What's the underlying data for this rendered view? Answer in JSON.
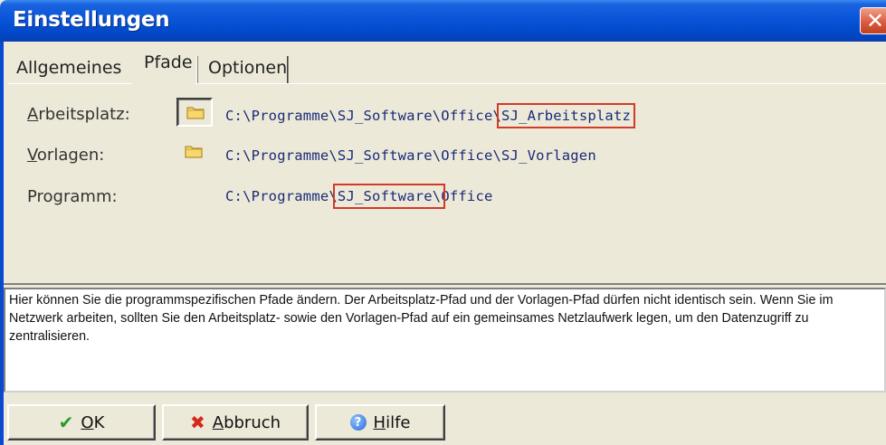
{
  "window": {
    "title": "Einstellungen"
  },
  "tabs": [
    {
      "label": "Allgemeines"
    },
    {
      "label": "Pfade"
    },
    {
      "label": "Optionen"
    }
  ],
  "paths": {
    "arbeitsplatz": {
      "label_key": "A",
      "label_rest": "rbeitsplatz:",
      "value_prefix": "C:\\Programme\\SJ_Software\\Office\\",
      "value_highlight": "SJ_Arbeitsplatz",
      "value_suffix": ""
    },
    "vorlagen": {
      "label_key": "V",
      "label_rest": "orlagen:",
      "value": "C:\\Programme\\SJ_Software\\Office\\SJ_Vorlagen"
    },
    "programm": {
      "label": "Programm:",
      "value_prefix": "C:\\Programme\\",
      "value_highlight": "SJ_Software\\",
      "value_suffix": "Office"
    }
  },
  "info_text": "Hier können Sie die programmspezifischen Pfade ändern. Der Arbeitsplatz-Pfad und der Vorlagen-Pfad dürfen nicht identisch sein. Wenn Sie im Netzwerk arbeiten, sollten Sie den Arbeitsplatz- sowie den Vorlagen-Pfad auf ein gemeinsames Netzlaufwerk legen, um den Datenzugriff zu zentralisieren.",
  "buttons": {
    "ok": {
      "key": "O",
      "rest": "K",
      "icon": "checkmark-icon"
    },
    "cancel": {
      "key": "A",
      "rest": "bbruch",
      "icon": "cross-icon"
    },
    "help": {
      "key": "H",
      "rest": "ilfe",
      "icon": "help-icon"
    }
  },
  "colors": {
    "titlebar": "#0a55d8",
    "path_text": "#1a2a78",
    "highlight_box": "#d23a2a",
    "ok_icon": "#2a9a2a",
    "cancel_icon": "#d32a1a"
  }
}
